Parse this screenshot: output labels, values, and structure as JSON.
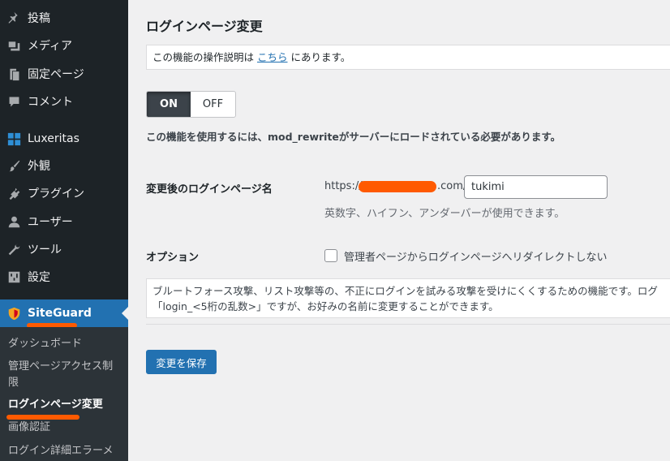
{
  "sidebar": {
    "items": [
      {
        "label": "投稿",
        "icon": "pushpin-icon"
      },
      {
        "label": "メディア",
        "icon": "media-icon"
      },
      {
        "label": "固定ページ",
        "icon": "page-icon"
      },
      {
        "label": "コメント",
        "icon": "comment-icon"
      },
      {
        "label": "Luxeritas",
        "icon": "grid-icon"
      },
      {
        "label": "外観",
        "icon": "paintbrush-icon"
      },
      {
        "label": "プラグイン",
        "icon": "plugin-icon"
      },
      {
        "label": "ユーザー",
        "icon": "user-icon"
      },
      {
        "label": "ツール",
        "icon": "wrench-icon"
      },
      {
        "label": "設定",
        "icon": "settings-icon"
      },
      {
        "label": "SiteGuard",
        "icon": "siteguard-shield-icon"
      }
    ],
    "submenu": [
      {
        "label": "ダッシュボード"
      },
      {
        "label": "管理ページアクセス制"
      },
      {
        "label": "限"
      },
      {
        "label": "ログインページ変更"
      },
      {
        "label": "画像認証"
      },
      {
        "label": "ログイン詳細エラーメ"
      }
    ]
  },
  "main": {
    "title": "ログインページ変更",
    "notice_before": "この機能の操作説明は ",
    "notice_link": "こちら",
    "notice_after": " にあります。",
    "toggle_on": "ON",
    "toggle_off": "OFF",
    "requirement": "この機能を使用するには、mod_rewriteがサーバーにロードされている必要があります。",
    "login_name_label": "変更後のログインページ名",
    "url_prefix": "https://",
    "url_suffix": ".com/",
    "login_name_value": "tukimi",
    "hint": "英数字、ハイフン、アンダーバーが使用できます。",
    "option_label": "オプション",
    "option_checkbox": "管理者ページからログインページへリダイレクトしない",
    "option_checked": false,
    "desc_line1": "ブルートフォース攻撃、リスト攻撃等の、不正にログインを試みる攻撃を受けにくくするための機能です。ログ",
    "desc_line2": "「login_<5桁の乱数>」ですが、お好みの名前に変更することができます。",
    "save_label": "変更を保存"
  },
  "colors": {
    "sidebar_bg": "#1d2327",
    "submenu_bg": "#2c3338",
    "accent": "#2271b1",
    "highlight_marker": "#ff5a00"
  }
}
